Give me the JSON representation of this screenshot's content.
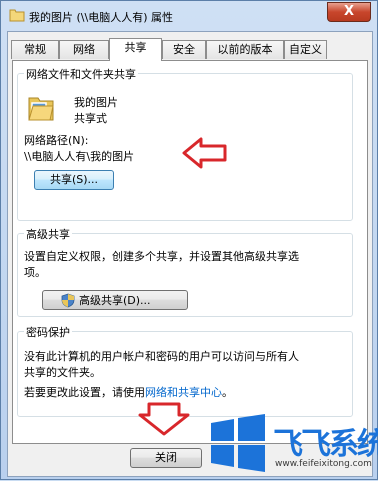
{
  "window": {
    "title": "我的图片 (\\\\电脑人人有) 属性",
    "close_glyph": "X"
  },
  "tabs": [
    {
      "label": "常规"
    },
    {
      "label": "网络"
    },
    {
      "label": "共享"
    },
    {
      "label": "安全"
    },
    {
      "label": "以前的版本"
    },
    {
      "label": "自定义"
    }
  ],
  "network_sharing": {
    "group_title": "网络文件和文件夹共享",
    "folder_name": "我的图片",
    "share_state": "共享式",
    "path_label": "网络路径(N):",
    "path_value": "\\\\电脑人人有\\我的图片",
    "share_button": "共享(S)..."
  },
  "advanced_sharing": {
    "group_title": "高级共享",
    "description": "设置自定义权限，创建多个共享，并设置其他高级共享选项。",
    "description_line1": "设置自定义权限，创建多个共享，并设置其他高级共享选",
    "description_line2": "项。",
    "button": "高级共享(D)..."
  },
  "password_protection": {
    "group_title": "密码保护",
    "line1": "没有此计算机的用户帐户和密码的用户可以访问与所有人",
    "line2": "共享的文件夹。",
    "line3_prefix": "若要更改此设置，请使用",
    "link": "网络和共享中心",
    "line3_suffix": "。"
  },
  "footer": {
    "close_button": "关闭"
  },
  "watermark": {
    "brand": "飞飞系统",
    "url": "www.feifeixitong.com"
  },
  "colors": {
    "arrow": "#d8272b",
    "link": "#0066cc",
    "brand_blue": "#1c73d9"
  }
}
